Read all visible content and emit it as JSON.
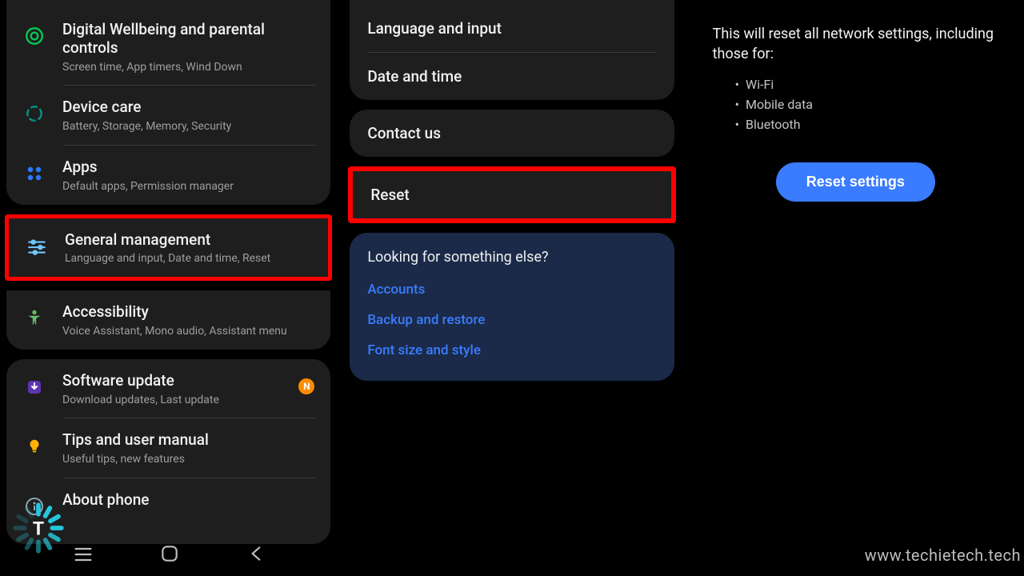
{
  "col1": {
    "card1": [
      {
        "title": "Digital Wellbeing and parental controls",
        "sub": "Screen time, App timers, Wind Down",
        "icon": "wellbeing"
      },
      {
        "title": "Device care",
        "sub": "Battery, Storage, Memory, Security",
        "icon": "devicecare"
      },
      {
        "title": "Apps",
        "sub": "Default apps, Permission manager",
        "icon": "apps"
      }
    ],
    "gm": {
      "title": "General management",
      "sub": "Language and input, Date and time, Reset",
      "icon": "sliders"
    },
    "a11y": {
      "title": "Accessibility",
      "sub": "Voice Assistant, Mono audio, Assistant menu",
      "icon": "a11y"
    },
    "card3": [
      {
        "title": "Software update",
        "sub": "Download updates, Last update",
        "icon": "swupdate",
        "badge": "N"
      },
      {
        "title": "Tips and user manual",
        "sub": "Useful tips, new features",
        "icon": "bulb"
      },
      {
        "title": "About phone",
        "sub": "",
        "icon": "info"
      }
    ]
  },
  "col2": {
    "card1": [
      "Language and input",
      "Date and time"
    ],
    "card2": [
      "Contact us"
    ],
    "reset": "Reset",
    "looking": {
      "title": "Looking for something else?",
      "links": [
        "Accounts",
        "Backup and restore",
        "Font size and style"
      ]
    }
  },
  "col3": {
    "desc": "This will reset all network settings, including those for:",
    "bullets": [
      "Wi-Fi",
      "Mobile data",
      "Bluetooth"
    ],
    "button": "Reset settings"
  },
  "watermark": "www.techietech.tech"
}
